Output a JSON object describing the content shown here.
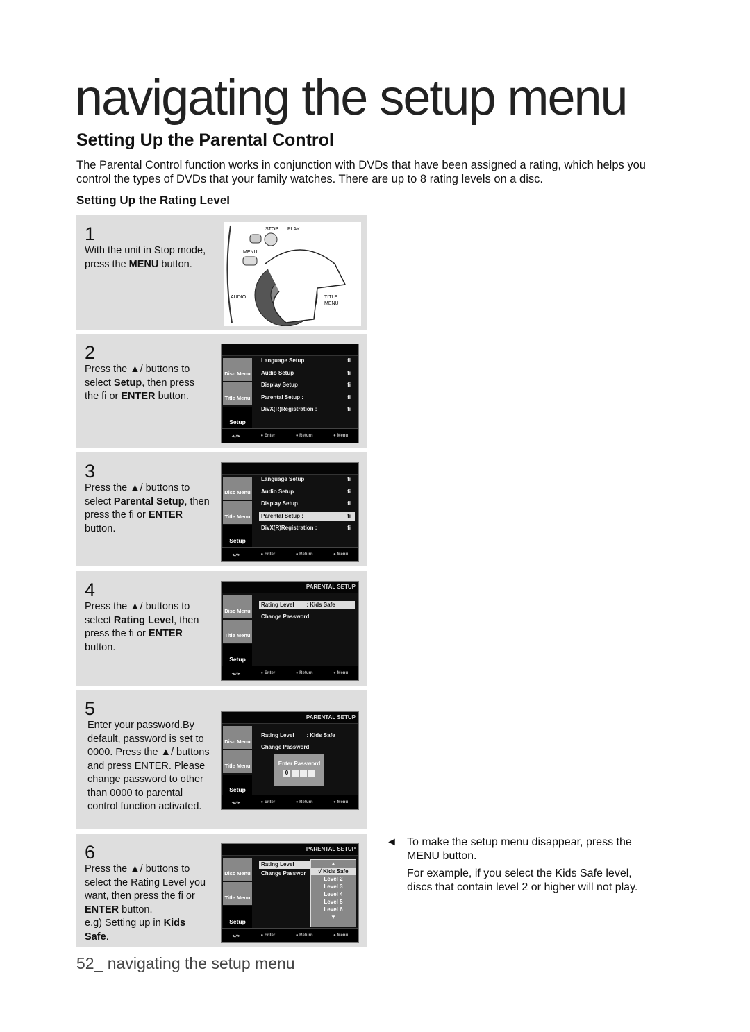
{
  "header": {
    "title": "navigating the setup menu"
  },
  "section": {
    "title": "Setting Up the Parental Control",
    "intro": "The Parental Control function works in conjunction with DVDs that have been assigned a rating, which helps you control the types of DVDs that your family watches. There are up to 8 rating levels on a disc.",
    "subtitle": "Setting Up the Rating Level"
  },
  "remote": {
    "stop": "STOP",
    "play": "PLAY",
    "menu": "MENU",
    "audio": "AUDIO",
    "title": "TITLE",
    "title_menu": "MENU"
  },
  "steps": [
    {
      "num": "1",
      "html": "With the unit in Stop mode, press the <b>MENU</b> button."
    },
    {
      "num": "2",
      "html": "Press the ▲/  buttons to select <b>Setup</b>, then press the ﬁ or <b>ENTER</b> button."
    },
    {
      "num": "3",
      "html": "Press the ▲/  buttons to select <b>Parental Setup</b>, then press the ﬁ or <b>ENTER</b> button."
    },
    {
      "num": "4",
      "html": "Press the ▲/  buttons to select <b>Rating Level</b>, then press the ﬁ or <b>ENTER</b> button."
    },
    {
      "num": "5",
      "html": "Enter your password.By default, password is set to 0000. Press the ▲/  buttons and press ENTER. Please change password to other than 0000 to parental control function activated."
    },
    {
      "num": "6",
      "html": "Press the ▲/  buttons to select the Rating Level you want, then press the ﬁ or <b>ENTER</b> button.<br>e.g) Setting up in <b>Kids Safe</b>."
    }
  ],
  "screen": {
    "side": [
      "Disc Menu",
      "Title Menu",
      "Setup"
    ],
    "footer": [
      "Enter",
      "Return",
      "Menu"
    ],
    "setup_items": [
      "Language Setup",
      "Audio Setup",
      "Display Setup",
      "Parental Setup :",
      "DivX(R)Registration :"
    ],
    "arrow": "ﬁ",
    "parental_title": "PARENTAL SETUP",
    "rating_label": "Rating Level",
    "rating_value": ": Kids Safe",
    "change_password": "Change Password",
    "change_password_cut": "Change Passwor",
    "enter_password": "Enter Password",
    "password_digit": "0",
    "levels": [
      "√ Kids Safe",
      "Level 2",
      "Level 3",
      "Level 4",
      "Level 5",
      "Level 6"
    ]
  },
  "note": {
    "line1": "To make the setup menu disappear, press the MENU button.",
    "line2": "For example, if you select the Kids Safe level, discs that contain level 2 or higher will not play.",
    "bullet": "◄"
  },
  "footer": {
    "page": "52_ navigating the setup menu"
  }
}
